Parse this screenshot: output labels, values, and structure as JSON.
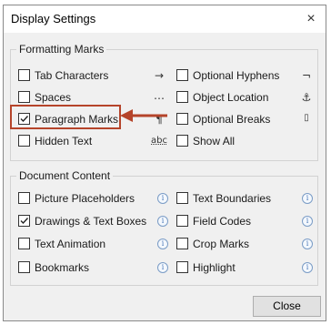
{
  "window": {
    "title": "Display Settings",
    "close_glyph": "×"
  },
  "formatting_marks": {
    "title": "Formatting Marks",
    "left": [
      {
        "label": "Tab Characters",
        "checked": false,
        "symbol": "→"
      },
      {
        "label": "Spaces",
        "checked": false,
        "symbol": "…"
      },
      {
        "label": "Paragraph Marks",
        "checked": true,
        "symbol": "¶"
      },
      {
        "label": "Hidden Text",
        "checked": false,
        "symbol": "abc"
      }
    ],
    "right": [
      {
        "label": "Optional Hyphens",
        "checked": false,
        "symbol": "¬"
      },
      {
        "label": "Object Location",
        "checked": false,
        "symbol": "⚓"
      },
      {
        "label": "Optional Breaks",
        "checked": false,
        "symbol": "▯"
      },
      {
        "label": "Show All",
        "checked": false,
        "symbol": ""
      }
    ]
  },
  "document_content": {
    "title": "Document Content",
    "left": [
      {
        "label": "Picture Placeholders",
        "checked": false
      },
      {
        "label": "Drawings & Text Boxes",
        "checked": true
      },
      {
        "label": "Text Animation",
        "checked": false
      },
      {
        "label": "Bookmarks",
        "checked": false
      }
    ],
    "right": [
      {
        "label": "Text Boundaries",
        "checked": false
      },
      {
        "label": "Field Codes",
        "checked": false
      },
      {
        "label": "Crop Marks",
        "checked": false
      },
      {
        "label": "Highlight",
        "checked": false
      }
    ],
    "info_glyph": "i"
  },
  "buttons": {
    "close_label": "Close"
  },
  "colors": {
    "annotation": "#b5442a",
    "info": "#4a78b8"
  }
}
